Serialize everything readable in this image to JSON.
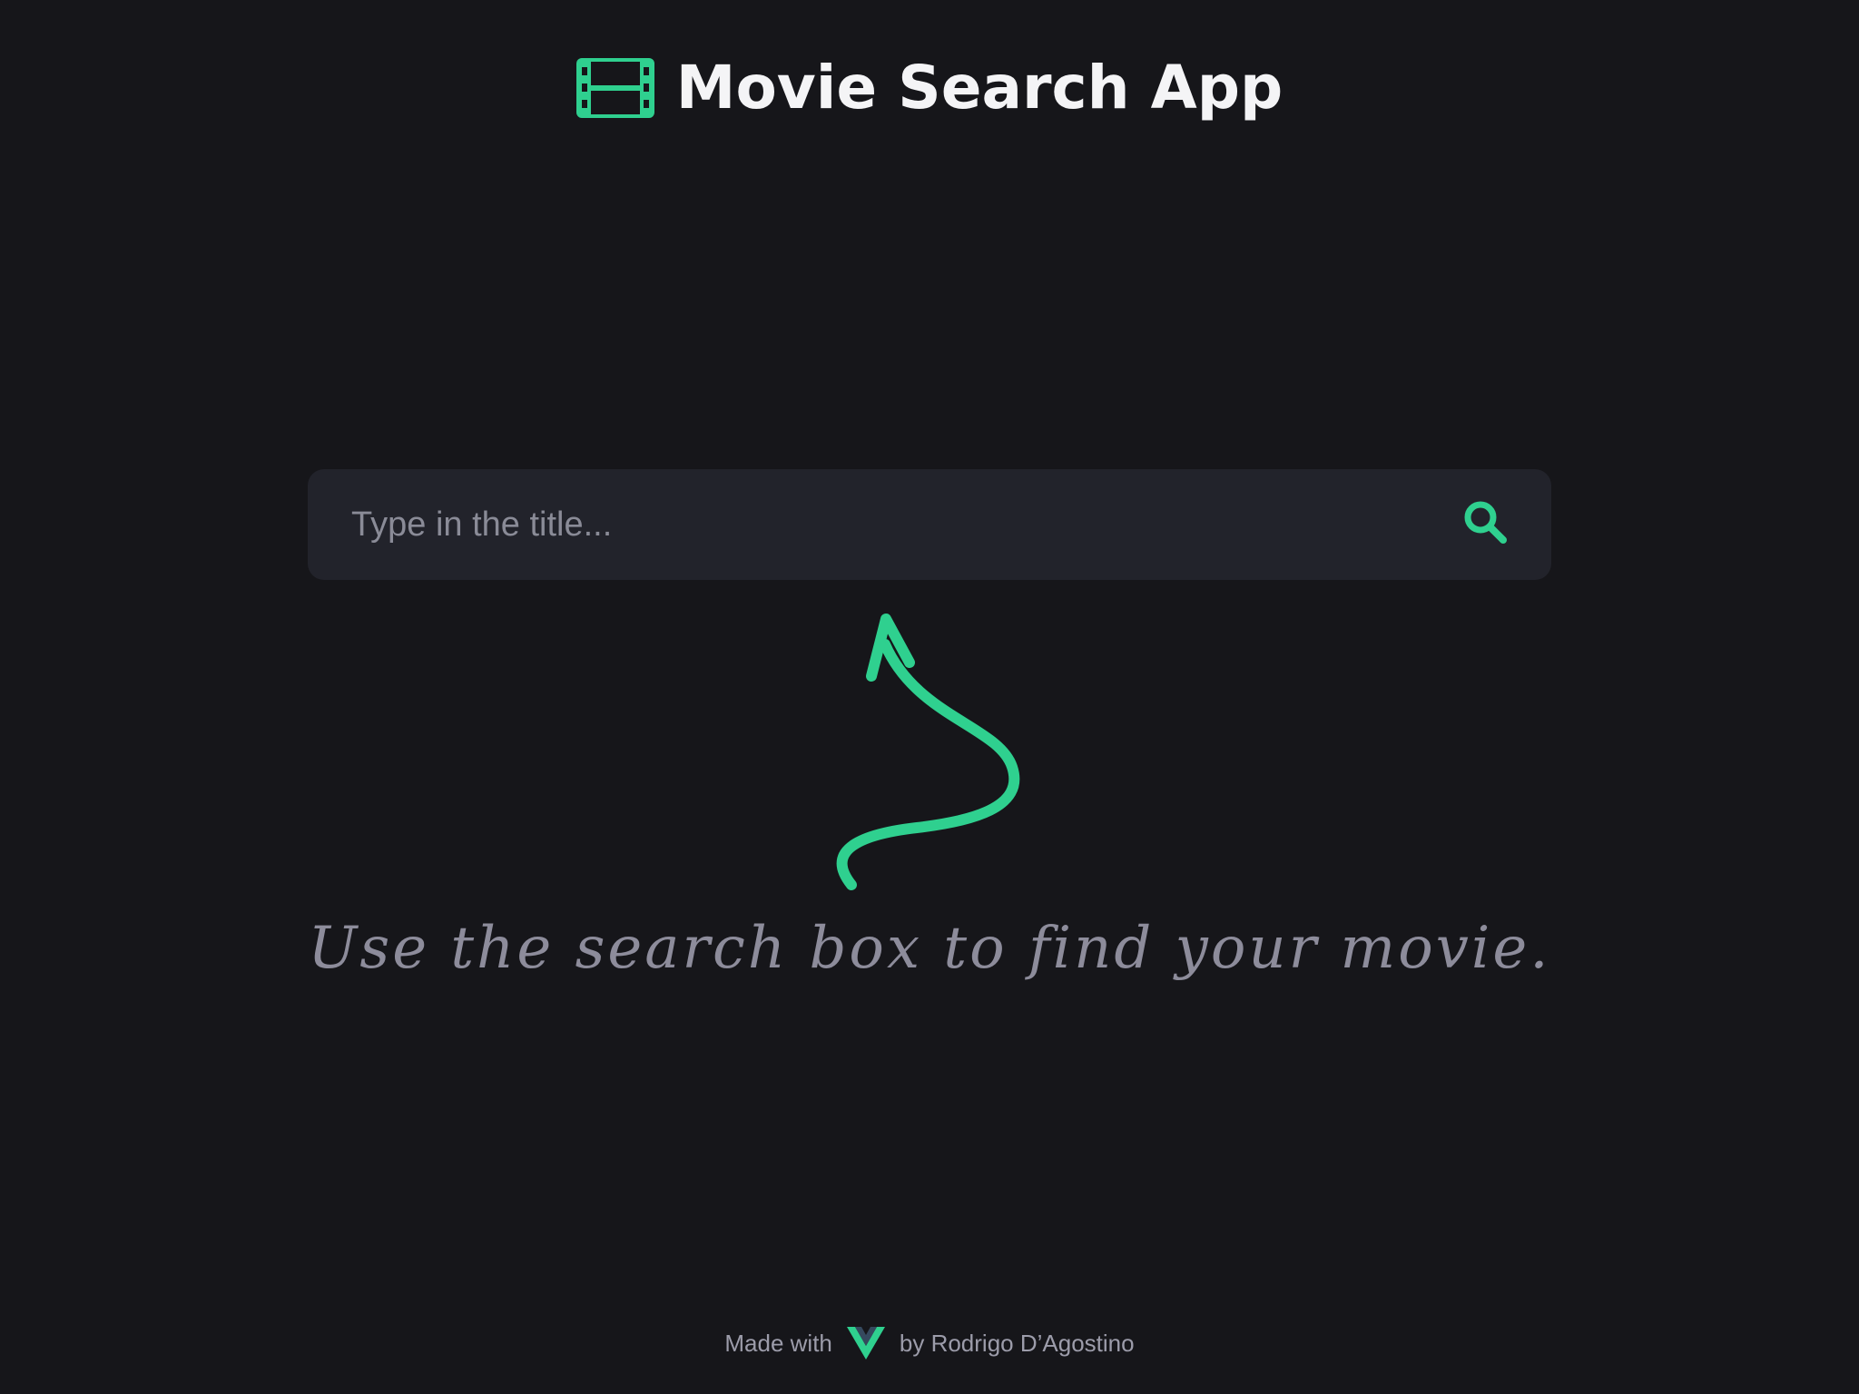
{
  "header": {
    "title": "Movie Search App",
    "icon": "film-icon"
  },
  "search": {
    "placeholder": "Type in the title...",
    "value": "",
    "button_icon": "search-icon"
  },
  "hint": {
    "text": "Use the search box to find your movie.",
    "icon": "curved-arrow-up-icon"
  },
  "footer": {
    "made_with": "Made with",
    "logo_icon": "vue-logo-icon",
    "author": "by Rodrigo D’Agostino"
  },
  "colors": {
    "background": "#16161a",
    "accent": "#2fd08f",
    "input_bg": "#22232b",
    "title": "#f4f4f6",
    "muted_text": "#8d8c9b"
  }
}
